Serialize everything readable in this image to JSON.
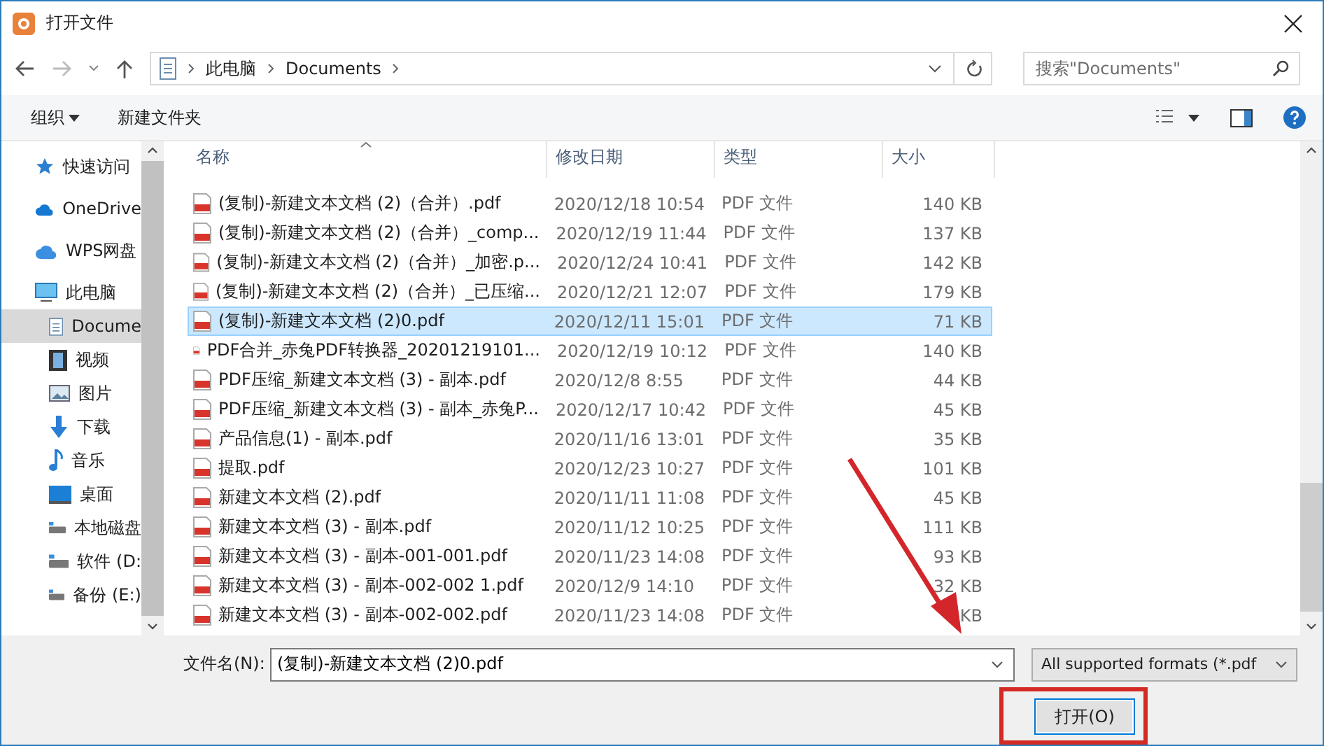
{
  "window": {
    "title": "打开文件"
  },
  "address": {
    "crumbs": [
      "此电脑",
      "Documents"
    ],
    "search_placeholder": "搜索\"Documents\""
  },
  "toolbar": {
    "organize": "组织",
    "new_folder": "新建文件夹"
  },
  "sidebar": {
    "items": [
      {
        "label": "快速访问",
        "selected": false
      },
      {
        "label": "OneDrive",
        "selected": false
      },
      {
        "label": "WPS网盘",
        "selected": false
      },
      {
        "label": "此电脑",
        "selected": false
      },
      {
        "label": "Docume",
        "selected": true
      },
      {
        "label": "视频",
        "selected": false
      },
      {
        "label": "图片",
        "selected": false
      },
      {
        "label": "下载",
        "selected": false
      },
      {
        "label": "音乐",
        "selected": false
      },
      {
        "label": "桌面",
        "selected": false
      },
      {
        "label": "本地磁盘",
        "selected": false
      },
      {
        "label": "软件 (D:",
        "selected": false
      },
      {
        "label": "备份 (E:)",
        "selected": false
      }
    ]
  },
  "table": {
    "columns": [
      "名称",
      "修改日期",
      "类型",
      "大小"
    ],
    "rows": [
      {
        "name": "(复制)-新建文本文档 (2)（合并）.pdf",
        "date": "2020/12/18 10:54",
        "type": "PDF 文件",
        "size": "140 KB",
        "selected": false
      },
      {
        "name": "(复制)-新建文本文档 (2)（合并）_comp...",
        "date": "2020/12/19 11:44",
        "type": "PDF 文件",
        "size": "137 KB",
        "selected": false
      },
      {
        "name": "(复制)-新建文本文档 (2)（合并）_加密.p...",
        "date": "2020/12/24 10:41",
        "type": "PDF 文件",
        "size": "142 KB",
        "selected": false
      },
      {
        "name": "(复制)-新建文本文档 (2)（合并）_已压缩...",
        "date": "2020/12/21 12:07",
        "type": "PDF 文件",
        "size": "179 KB",
        "selected": false
      },
      {
        "name": "(复制)-新建文本文档 (2)0.pdf",
        "date": "2020/12/11 15:01",
        "type": "PDF 文件",
        "size": "71 KB",
        "selected": true
      },
      {
        "name": "PDF合并_赤兔PDF转换器_20201219101...",
        "date": "2020/12/19 10:12",
        "type": "PDF 文件",
        "size": "140 KB",
        "selected": false
      },
      {
        "name": "PDF压缩_新建文本文档 (3) - 副本.pdf",
        "date": "2020/12/8 8:55",
        "type": "PDF 文件",
        "size": "44 KB",
        "selected": false
      },
      {
        "name": "PDF压缩_新建文本文档 (3) - 副本_赤兔P...",
        "date": "2020/12/17 10:42",
        "type": "PDF 文件",
        "size": "45 KB",
        "selected": false
      },
      {
        "name": "产品信息(1) - 副本.pdf",
        "date": "2020/11/16 13:01",
        "type": "PDF 文件",
        "size": "35 KB",
        "selected": false
      },
      {
        "name": "提取.pdf",
        "date": "2020/12/23 10:27",
        "type": "PDF 文件",
        "size": "101 KB",
        "selected": false
      },
      {
        "name": "新建文本文档 (2).pdf",
        "date": "2020/11/11 11:08",
        "type": "PDF 文件",
        "size": "45 KB",
        "selected": false
      },
      {
        "name": "新建文本文档 (3) - 副本.pdf",
        "date": "2020/11/12 10:25",
        "type": "PDF 文件",
        "size": "111 KB",
        "selected": false
      },
      {
        "name": "新建文本文档 (3) - 副本-001-001.pdf",
        "date": "2020/11/23 14:08",
        "type": "PDF 文件",
        "size": "93 KB",
        "selected": false
      },
      {
        "name": "新建文本文档 (3) - 副本-002-002 1.pdf",
        "date": "2020/12/9 14:10",
        "type": "PDF 文件",
        "size": "32 KB",
        "selected": false
      },
      {
        "name": "新建文本文档 (3) - 副本-002-002.pdf",
        "date": "2020/11/23 14:08",
        "type": "PDF 文件",
        "size": "KB",
        "selected": false
      }
    ]
  },
  "footer": {
    "filename_label": "文件名(N):",
    "filename": "(复制)-新建文本文档 (2)0.pdf",
    "filter": "All supported formats (*.pdf",
    "open": "打开(O)"
  }
}
